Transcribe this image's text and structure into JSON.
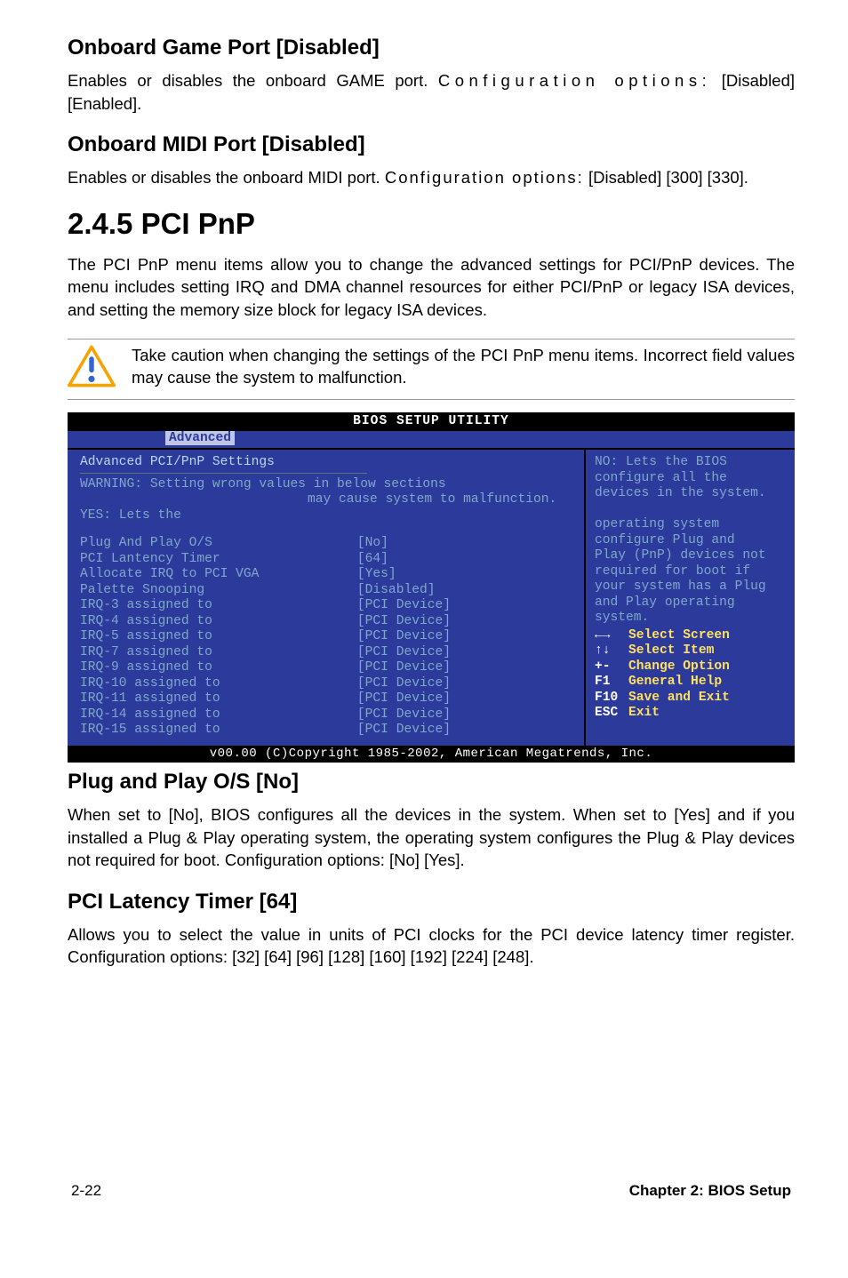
{
  "sec1": {
    "h": "Onboard Game Port [Disabled]",
    "p_a": "Enables or disables the onboard GAME port. ",
    "p_b": "Configuration options:",
    "p_c": " [Disabled] [Enabled]."
  },
  "sec2": {
    "h": "Onboard MIDI Port [Disabled]",
    "p_a": "Enables or disables the onboard MIDI port. ",
    "p_b": "Configuration options:",
    "p_c": " [Disabled] [300] [330]."
  },
  "pnp": {
    "h": "2.4.5 PCI PnP",
    "p": "The PCI PnP menu items allow you to change the advanced settings for PCI/PnP devices. The menu includes setting IRQ and DMA channel resources for either PCI/PnP or legacy ISA devices, and setting the memory size block for legacy ISA devices."
  },
  "warn": "Take caution when changing the settings of the PCI PnP menu items. Incorrect field values may cause the system to malfunction.",
  "bios": {
    "title": "BIOS SETUP UTILITY",
    "tab": "Advanced",
    "left_title": "Advanced PCI/PnP Settings",
    "warn1": "WARNING: Setting wrong values in below sections",
    "warn2": "may cause system to malfunction.",
    "yes": "YES: Lets the",
    "rows": [
      {
        "l": "Plug And Play O/S",
        "v": "[No]"
      },
      {
        "l": "PCI Lantency Timer",
        "v": "[64]"
      },
      {
        "l": "Allocate IRQ to PCI VGA",
        "v": "[Yes]"
      },
      {
        "l": "Palette Snooping",
        "v": "[Disabled]"
      },
      {
        "l": "IRQ-3 assigned to",
        "v": "[PCI Device]"
      },
      {
        "l": "IRQ-4 assigned to",
        "v": "[PCI Device]"
      },
      {
        "l": "IRQ-5 assigned to",
        "v": "[PCI Device]"
      },
      {
        "l": "IRQ-7 assigned to",
        "v": "[PCI Device]"
      },
      {
        "l": "IRQ-9 assigned to",
        "v": "[PCI Device]"
      },
      {
        "l": "IRQ-10 assigned to",
        "v": "[PCI Device]"
      },
      {
        "l": "IRQ-11 assigned to",
        "v": "[PCI Device]"
      },
      {
        "l": "IRQ-14 assigned to",
        "v": "[PCI Device]"
      },
      {
        "l": "IRQ-15 assigned to",
        "v": "[PCI Device]"
      }
    ],
    "right": [
      "NO: Lets the BIOS",
      "configure all the",
      "devices in the system.",
      "",
      "operating system",
      "configure Plug and",
      "Play (PnP) devices not",
      "required for boot if",
      "your system has a Plug",
      "and Play operating",
      "system."
    ],
    "help": [
      {
        "k": "←→",
        "v": "Select Screen"
      },
      {
        "k": "↑↓",
        "v": "Select Item"
      },
      {
        "k": "+-",
        "v": "Change Option"
      },
      {
        "k": "F1",
        "v": "General Help"
      },
      {
        "k": "F10",
        "v": "Save and Exit"
      },
      {
        "k": "ESC",
        "v": "Exit"
      }
    ],
    "bottom": "v00.00 (C)Copyright 1985-2002, American Megatrends, Inc."
  },
  "plug": {
    "h": "Plug and Play O/S [No]",
    "p": "When set to [No], BIOS configures all the devices in the system. When set to [Yes] and if you installed a Plug & Play operating system, the operating system configures the Plug & Play devices not required for boot. Configuration options: [No] [Yes]."
  },
  "lat": {
    "h": "PCI Latency Timer [64]",
    "p": "Allows you to select the value in units of PCI clocks for the PCI device latency timer register. Configuration options: [32] [64] [96] [128] [160] [192] [224] [248]."
  },
  "foot": {
    "l": "2-22",
    "r": "Chapter 2: BIOS Setup"
  }
}
